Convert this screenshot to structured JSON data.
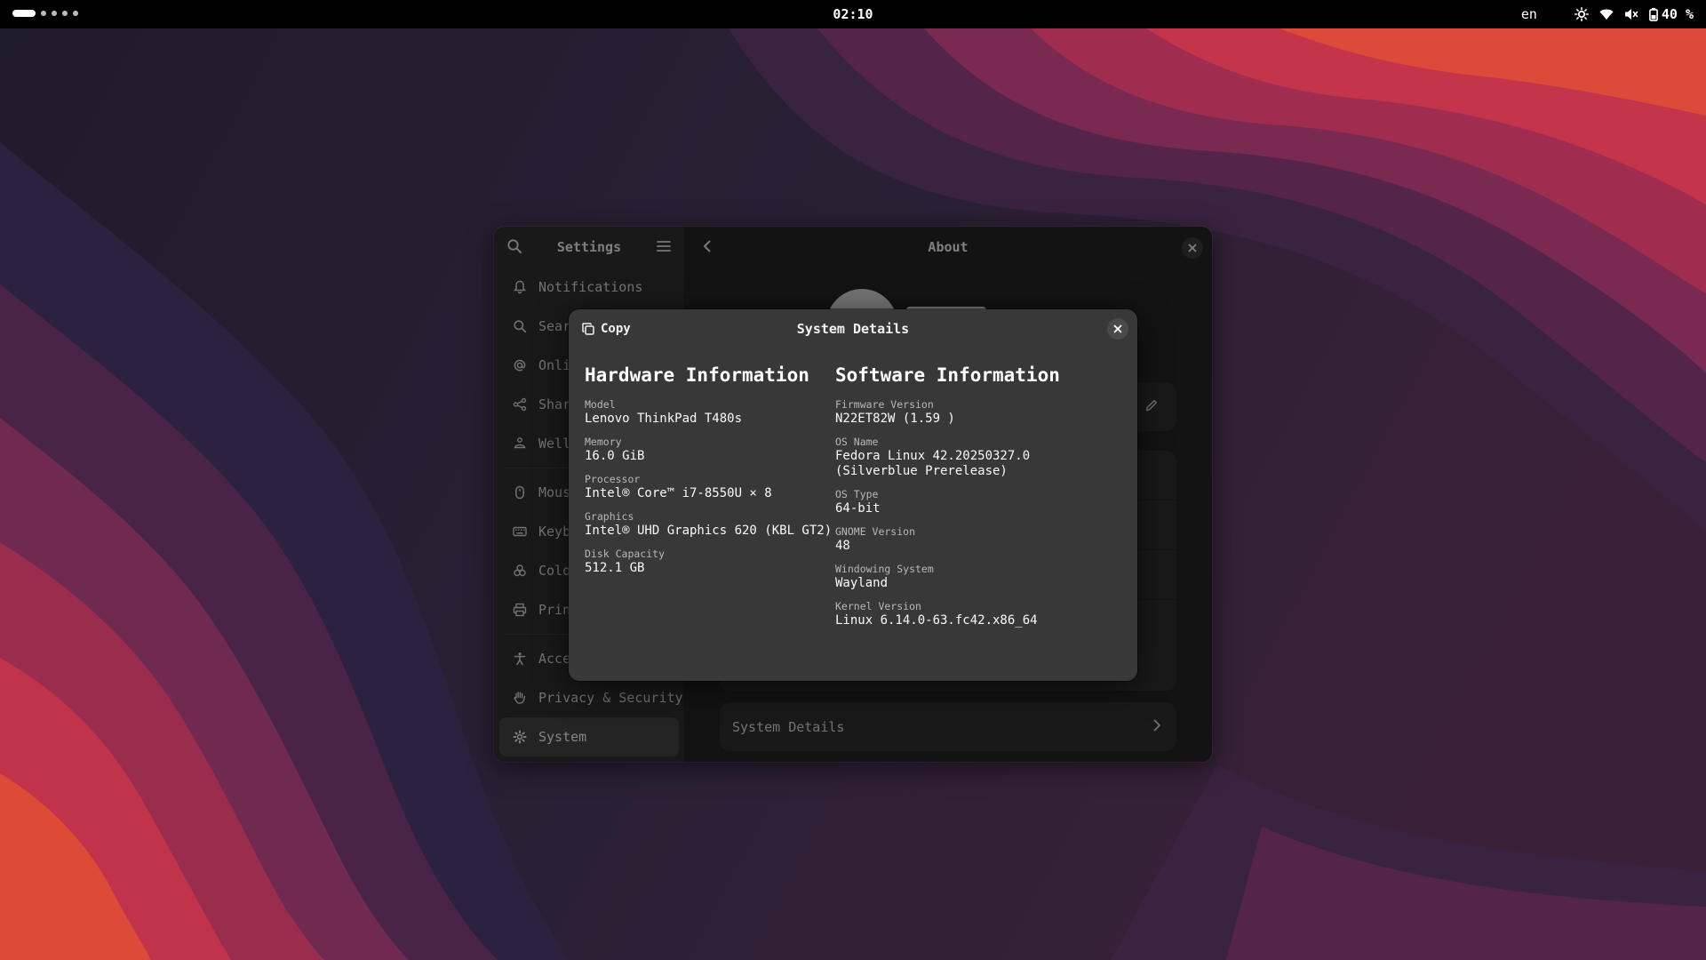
{
  "topbar": {
    "clock": "02:10",
    "language": "en",
    "battery_percent": "40 %",
    "tray_icons": [
      "brightness-icon",
      "wifi-icon",
      "volume-muted-icon",
      "battery-icon"
    ]
  },
  "settings": {
    "sidebar_title": "Settings",
    "sidebar_items": [
      {
        "label": "Notifications",
        "icon": "bell-icon"
      },
      {
        "label": "Search",
        "icon": "search-icon"
      },
      {
        "label": "Online Accounts",
        "icon": "at-icon"
      },
      {
        "label": "Sharing",
        "icon": "share-icon"
      },
      {
        "label": "Wellbeing",
        "icon": "wellbeing-icon"
      },
      {
        "label": "Mouse & Touchpad",
        "icon": "mouse-icon"
      },
      {
        "label": "Keyboard",
        "icon": "keyboard-icon"
      },
      {
        "label": "Color",
        "icon": "color-icon"
      },
      {
        "label": "Printers",
        "icon": "printer-icon"
      },
      {
        "label": "Accessibility",
        "icon": "accessibility-icon"
      },
      {
        "label": "Privacy & Security",
        "icon": "hand-icon"
      },
      {
        "label": "System",
        "icon": "gear-icon"
      }
    ],
    "active_item": "System",
    "content_title": "About",
    "system_details_label": "System Details"
  },
  "dialog": {
    "title": "System Details",
    "copy_label": "Copy",
    "hardware": {
      "heading": "Hardware Information",
      "fields": [
        {
          "key": "Model",
          "value": "Lenovo ThinkPad T480s"
        },
        {
          "key": "Memory",
          "value": "16.0 GiB"
        },
        {
          "key": "Processor",
          "value": "Intel® Core™ i7-8550U × 8"
        },
        {
          "key": "Graphics",
          "value": "Intel® UHD Graphics 620 (KBL GT2)"
        },
        {
          "key": "Disk Capacity",
          "value": "512.1 GB"
        }
      ]
    },
    "software": {
      "heading": "Software Information",
      "fields": [
        {
          "key": "Firmware Version",
          "value": "N22ET82W (1.59 )"
        },
        {
          "key": "OS Name",
          "value": "Fedora Linux 42.20250327.0 (Silverblue Prerelease)"
        },
        {
          "key": "OS Type",
          "value": "64-bit"
        },
        {
          "key": "GNOME Version",
          "value": "48"
        },
        {
          "key": "Windowing System",
          "value": "Wayland"
        },
        {
          "key": "Kernel Version",
          "value": "Linux 6.14.0-63.fc42.x86_64"
        }
      ]
    }
  }
}
